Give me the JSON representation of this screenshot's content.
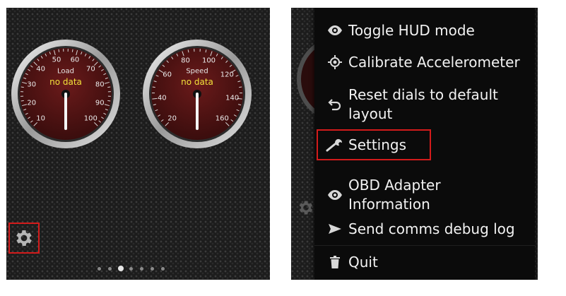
{
  "left_screen": {
    "gauges": [
      {
        "label": "Load",
        "status": "no data",
        "ticks": [
          "10",
          "20",
          "30",
          "40",
          "50",
          "60",
          "70",
          "80",
          "90",
          "100"
        ]
      },
      {
        "label": "Speed",
        "status": "no data",
        "ticks": [
          "20",
          "40",
          "60",
          "80",
          "100",
          "120",
          "140",
          "160"
        ]
      }
    ],
    "settings_icon": "gear-icon",
    "page_indicator": {
      "count": 7,
      "active": 3
    }
  },
  "menu": {
    "items": [
      {
        "label": "Toggle HUD mode",
        "icon": "eye-icon"
      },
      {
        "label": "Calibrate Accelerometer",
        "icon": "crosshair-icon"
      },
      {
        "label": "Reset dials to default layout",
        "icon": "undo-icon"
      },
      {
        "label": "Settings",
        "icon": "wrench-icon"
      },
      {
        "label": "OBD Adapter Information",
        "icon": "eye-icon"
      },
      {
        "label": "Send comms debug log",
        "icon": "send-icon"
      },
      {
        "label": "Quit",
        "icon": "trash-icon"
      }
    ]
  },
  "colors": {
    "highlight": "#d31b1b",
    "dial_face": "#4a1414",
    "status_text": "#f3e23a"
  }
}
